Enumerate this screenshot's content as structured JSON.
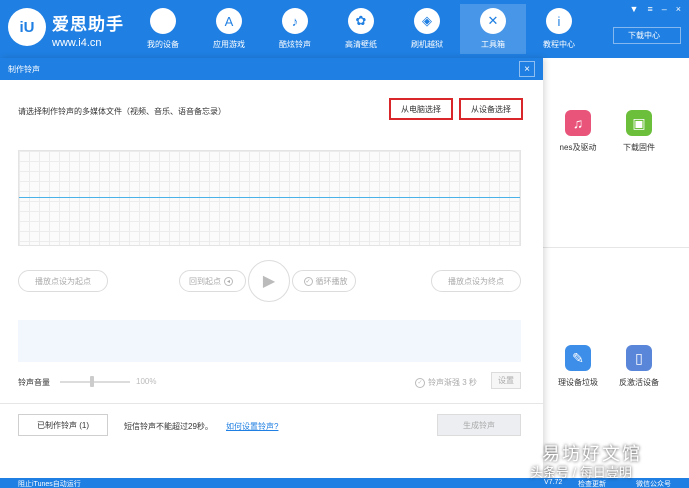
{
  "app": {
    "logo_text": "iU",
    "name": "爱思助手",
    "url": "www.i4.cn",
    "download_center": "下载中心"
  },
  "nav": [
    {
      "label": "我的设备",
      "icon": "apple-icon"
    },
    {
      "label": "应用游戏",
      "icon": "app-store-icon"
    },
    {
      "label": "酷炫铃声",
      "icon": "bell-icon"
    },
    {
      "label": "高清壁纸",
      "icon": "flower-icon"
    },
    {
      "label": "刷机越狱",
      "icon": "dropbox-icon"
    },
    {
      "label": "工具箱",
      "icon": "tools-icon"
    },
    {
      "label": "教程中心",
      "icon": "info-icon"
    }
  ],
  "background_tools": [
    {
      "label": "nes及驱动",
      "icon": "itunes-icon",
      "color": "#e8547a"
    },
    {
      "label": "下载固件",
      "icon": "firmware-box-icon",
      "color": "#6bbf3b"
    },
    {
      "label": "理设备垃圾",
      "icon": "broom-icon",
      "color": "#3d8ee8"
    },
    {
      "label": "反激活设备",
      "icon": "phone-icon",
      "color": "#5a86d9"
    }
  ],
  "dialog": {
    "title": "制作铃声",
    "close_glyph": "×",
    "instruction": "请选择制作铃声的多媒体文件（视频、音乐、语音备忘录）",
    "from_pc_button": "从电脑选择",
    "from_device_button": "从设备选择",
    "set_start_button": "播放点设为起点",
    "back_to_start_button": "回到起点",
    "loop_play_button": "循环播放",
    "set_end_button": "播放点设为终点",
    "volume_label": "铃声音量",
    "volume_value": "100%",
    "volume_level": 0.6,
    "fade_label": "铃声渐强 3 秒",
    "settings_button": "设置",
    "made_ringtones_button": "已制作铃声 (1)",
    "sms_note": "短信铃声不能超过29秒。",
    "howto_link": "如何设置铃声?",
    "generate_button": "生成铃声"
  },
  "statusbar": {
    "left_text": "阻止iTunes自动运行",
    "version": "V7.72",
    "check_update": "检查更新",
    "wechat": "微信公众号"
  },
  "watermark": {
    "line1": "易坊好文馆",
    "line2": "头条号 / 每日壹明"
  },
  "colors": {
    "brand_blue": "#1f7fe2",
    "highlight_red": "#d9262b",
    "wave_line": "#4ab0e8"
  }
}
